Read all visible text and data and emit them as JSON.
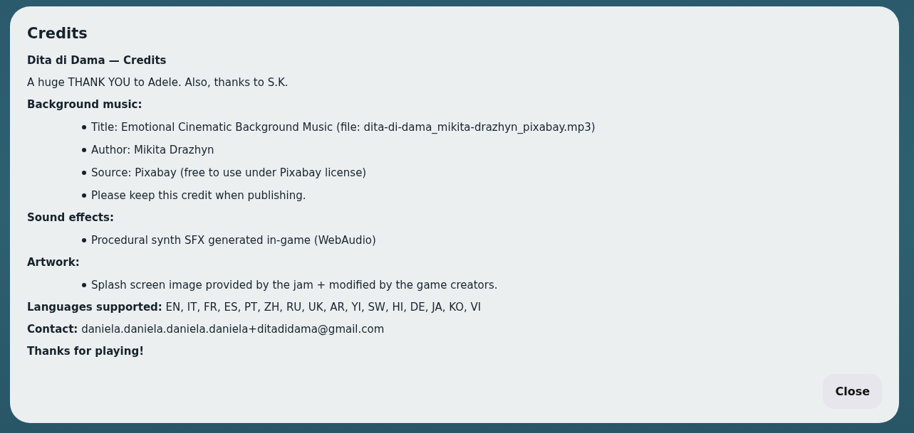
{
  "dialog": {
    "title": "Credits",
    "blocks": [
      {
        "kind": "heading",
        "text": "Dita di Dama — Credits"
      },
      {
        "kind": "text",
        "text": "A huge THANK YOU to Adele. Also, thanks to S.K."
      },
      {
        "kind": "heading",
        "text": "Background music:"
      },
      {
        "kind": "list",
        "items": [
          "Title: Emotional Cinematic Background Music (file: dita-di-dama_mikita-drazhyn_pixabay.mp3)",
          "Author: Mikita Drazhyn",
          "Source: Pixabay (free to use under Pixabay license)",
          "Please keep this credit when publishing."
        ]
      },
      {
        "kind": "heading",
        "text": "Sound effects:"
      },
      {
        "kind": "list",
        "items": [
          "Procedural synth SFX generated in-game (WebAudio)"
        ]
      },
      {
        "kind": "heading",
        "text": "Artwork:"
      },
      {
        "kind": "list",
        "items": [
          "Splash screen image provided by the jam + modified by the game creators."
        ]
      },
      {
        "kind": "text",
        "text": "**Languages supported:** EN, IT, FR, ES, PT, ZH, RU, UK, AR, YI, SW, HI, DE, JA, KO, VI"
      },
      {
        "kind": "text",
        "text": "**Contact:** daniela.daniela.daniela.daniela+ditadidama@gmail.com"
      },
      {
        "kind": "heading",
        "text": "Thanks for playing!"
      }
    ],
    "close_button": "Close"
  }
}
